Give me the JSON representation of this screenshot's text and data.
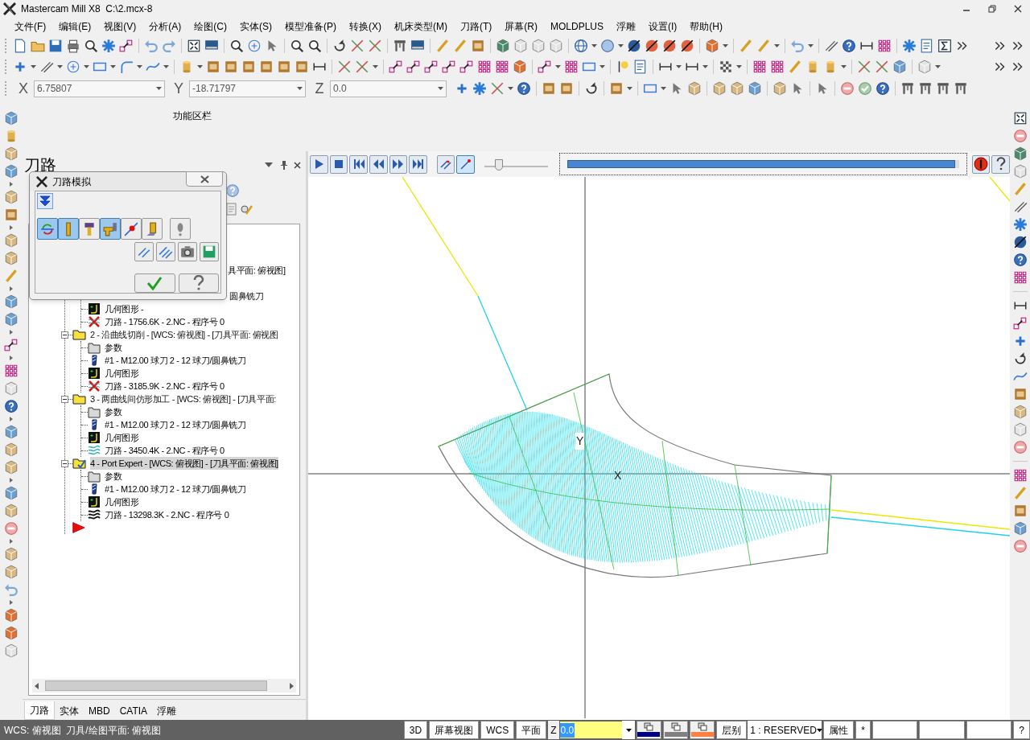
{
  "window": {
    "title": "Mastercam Mill X8  C:\\2.mcx-8"
  },
  "menu": [
    "文件(F)",
    "编辑(E)",
    "视图(V)",
    "分析(A)",
    "绘图(C)",
    "实体(S)",
    "模型准备(P)",
    "转换(X)",
    "机床类型(M)",
    "刀路(T)",
    "屏幕(R)",
    "MOLDPLUS",
    "浮雕",
    "设置(I)",
    "帮助(H)"
  ],
  "coordinates": [
    {
      "axis": "X",
      "value": "6.75807"
    },
    {
      "axis": "Y",
      "value": "-18.71797"
    },
    {
      "axis": "Z",
      "value": "0.0"
    }
  ],
  "ribbon": {
    "label": "功能区栏"
  },
  "panel": {
    "title": "刀路",
    "covered_operation": {
      "label": "具平面: 俯视图]",
      "tool_label": "圆鼻铣刀",
      "children": [
        {
          "kind": "geometry",
          "label": "几何图形 -"
        },
        {
          "kind": "toolpath_dirty",
          "label": "刀路 - 1756.6K - 2.NC - 程序号 0"
        }
      ]
    },
    "operations": [
      {
        "label": "2 - 沿曲线切削 - [WCS: 俯视图] - [刀具平面: 俯视图",
        "expanded": true,
        "selected": false,
        "children": [
          {
            "kind": "params",
            "label": "参数"
          },
          {
            "kind": "tool",
            "label": "#1 - M12.00 球刀 2 - 12 球刀/圆鼻铣刀"
          },
          {
            "kind": "geometry",
            "label": "几何图形"
          },
          {
            "kind": "toolpath_dirty",
            "label": "刀路 - 3185.9K - 2.NC - 程序号 0"
          }
        ]
      },
      {
        "label": "3 - 两曲线间仿形加工 - [WCS: 俯视图] - [刀具平面:",
        "expanded": true,
        "selected": false,
        "children": [
          {
            "kind": "params",
            "label": "参数"
          },
          {
            "kind": "tool",
            "label": "#1 - M12.00 球刀 2 - 12 球刀/圆鼻铣刀"
          },
          {
            "kind": "geometry",
            "label": "几何图形"
          },
          {
            "kind": "toolpath",
            "label": "刀路 - 3450.4K - 2.NC - 程序号 0"
          }
        ]
      },
      {
        "label": "4 - Port Expert - [WCS: 俯视图] - [刀具平面: 俯视图]",
        "expanded": true,
        "selected": true,
        "children": [
          {
            "kind": "params",
            "label": "参数"
          },
          {
            "kind": "tool",
            "label": "#1 - M12.00 球刀 2 - 12 球刀/圆鼻铣刀"
          },
          {
            "kind": "geometry",
            "label": "几何图形"
          },
          {
            "kind": "toolpath_active",
            "label": "刀路 - 13298.3K - 2.NC - 程序号 0"
          }
        ]
      }
    ],
    "tabs": [
      {
        "label": "刀路",
        "selected": true
      },
      {
        "label": "实体",
        "selected": false
      },
      {
        "label": "MBD",
        "selected": false
      },
      {
        "label": "CATIA",
        "selected": false
      },
      {
        "label": "浮雕",
        "selected": false
      }
    ]
  },
  "dialog": {
    "title": "刀路模拟",
    "options": [
      {
        "selected": true
      },
      {
        "selected": true
      },
      {
        "selected": false
      },
      {
        "selected": true
      },
      {
        "selected": false
      },
      {
        "selected": false
      },
      {
        "selected": false
      }
    ]
  },
  "simulation": {
    "view_options": [
      {
        "selected": false
      },
      {
        "selected": true
      }
    ],
    "speed": {
      "level": 0.18
    },
    "progress": {
      "level": 0.99
    }
  },
  "viewport": {
    "axis_labels": [
      {
        "kind": "y",
        "label": "Y"
      },
      {
        "kind": "x",
        "label": "X"
      }
    ]
  },
  "status_bar": {
    "text": "WCS: 俯视图  刀具/绘图平面: 俯视图",
    "items": [
      {
        "kind": "button",
        "label": "3D"
      },
      {
        "kind": "button",
        "label": "屏幕视图"
      },
      {
        "kind": "button",
        "label": "WCS"
      },
      {
        "kind": "button",
        "label": "平面"
      },
      {
        "kind": "label",
        "label": "Z"
      },
      {
        "kind": "field",
        "value": "0.0"
      },
      {
        "kind": "swatch",
        "color": "#000080"
      },
      {
        "kind": "swatch",
        "color": "#808080"
      },
      {
        "kind": "swatch",
        "color": "#ff8040"
      },
      {
        "kind": "button",
        "label": "层别"
      },
      {
        "kind": "dropdown",
        "value": "1 : RESERVED"
      },
      {
        "kind": "button",
        "label": "属性"
      },
      {
        "kind": "button",
        "label": "*"
      },
      {
        "kind": "blank"
      },
      {
        "kind": "blank"
      },
      {
        "kind": "blank"
      },
      {
        "kind": "button",
        "label": "?"
      }
    ]
  }
}
